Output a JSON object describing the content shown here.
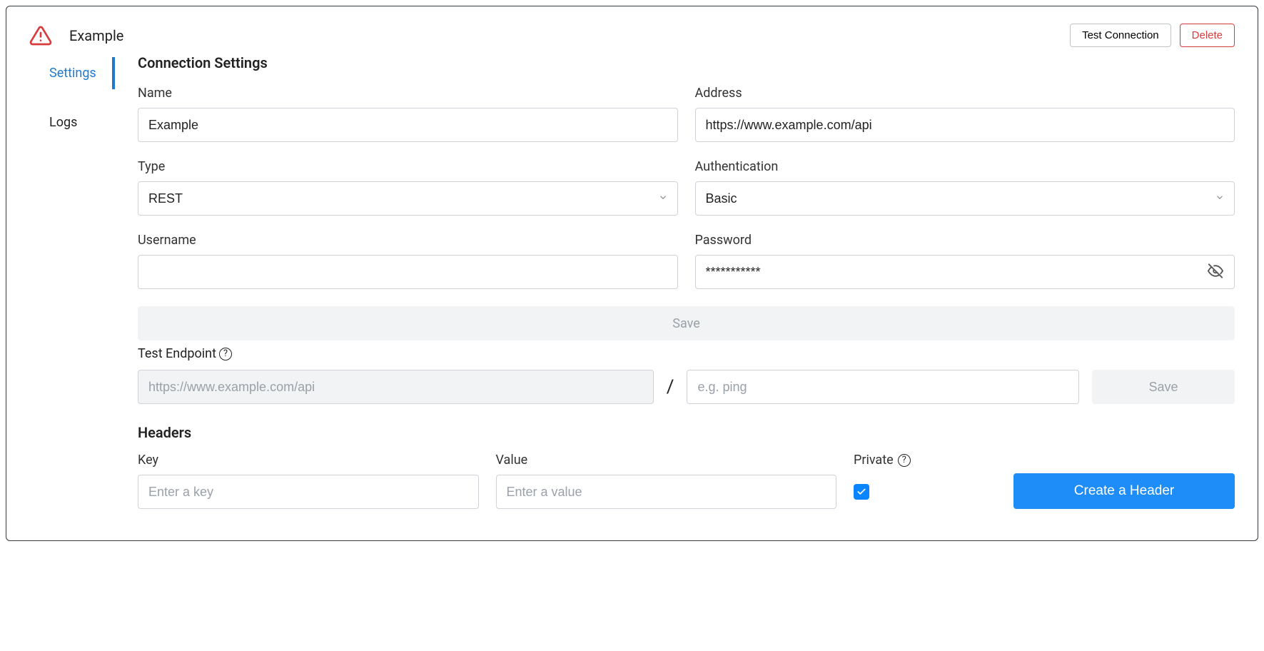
{
  "header": {
    "title": "Example",
    "actions": {
      "test_connection": "Test Connection",
      "delete": "Delete"
    }
  },
  "tabs": {
    "settings": "Settings",
    "logs": "Logs"
  },
  "section": {
    "connection_settings": "Connection Settings"
  },
  "fields": {
    "name": {
      "label": "Name",
      "value": "Example"
    },
    "address": {
      "label": "Address",
      "value": "https://www.example.com/api"
    },
    "type": {
      "label": "Type",
      "value": "REST"
    },
    "authentication": {
      "label": "Authentication",
      "value": "Basic"
    },
    "username": {
      "label": "Username",
      "value": ""
    },
    "password": {
      "label": "Password",
      "value": "***********"
    }
  },
  "buttons": {
    "save_main": "Save",
    "save_endpoint": "Save",
    "create_header": "Create a Header"
  },
  "test_endpoint": {
    "label": "Test Endpoint",
    "base_placeholder": "https://www.example.com/api",
    "path_placeholder": "e.g. ping"
  },
  "headers": {
    "title": "Headers",
    "key_label": "Key",
    "value_label": "Value",
    "private_label": "Private",
    "key_placeholder": "Enter a key",
    "value_placeholder": "Enter a value",
    "private_checked": true
  }
}
